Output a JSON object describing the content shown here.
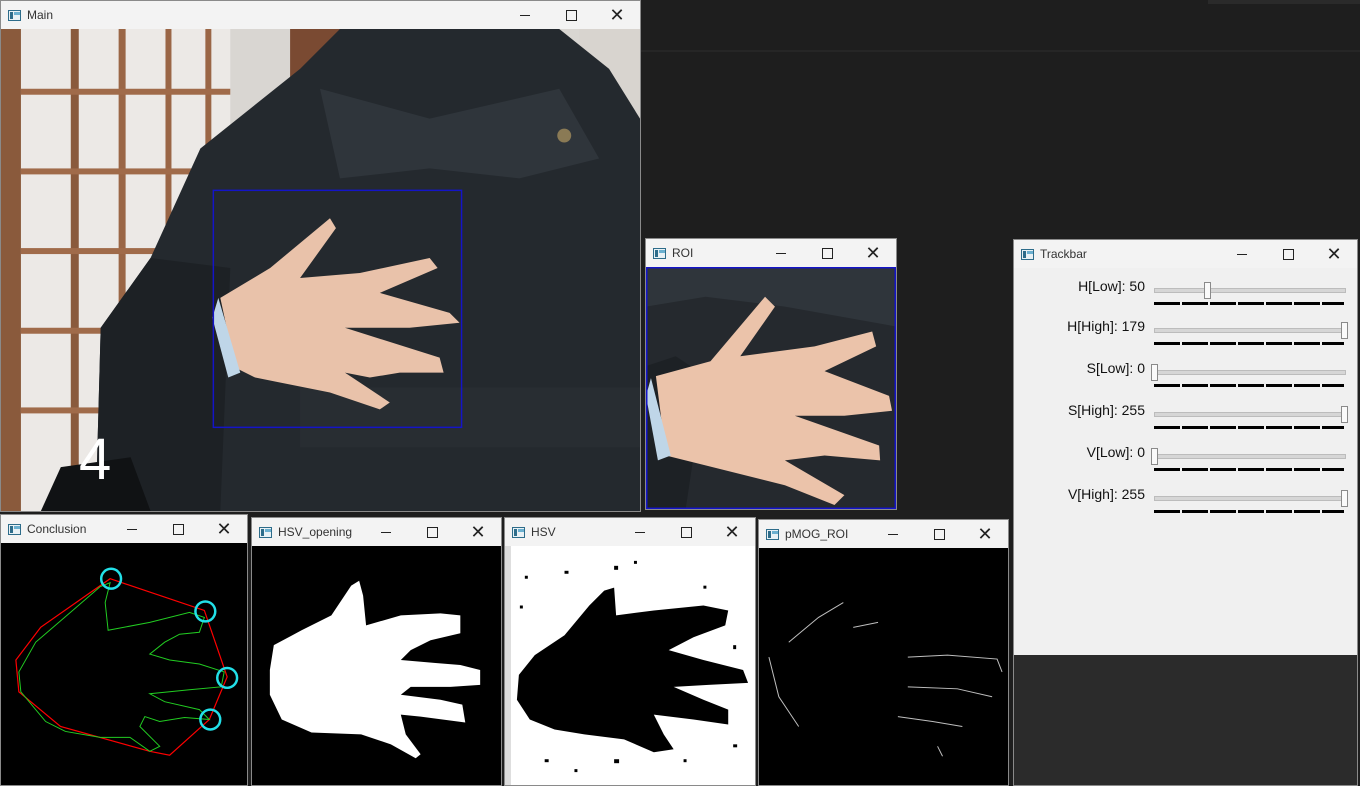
{
  "colors": {
    "desktop": "#1e1e1e",
    "roi_box": "#1414c8",
    "hull": "#ff0000",
    "contour": "#22cc22",
    "fingertip": "#22e0e8"
  },
  "windows": {
    "main": {
      "title": "Main",
      "overlay_digit": "4"
    },
    "roi": {
      "title": "ROI"
    },
    "trackbar": {
      "title": "Trackbar"
    },
    "conclusion": {
      "title": "Conclusion"
    },
    "hsv_opening": {
      "title": "HSV_opening"
    },
    "hsv": {
      "title": "HSV"
    },
    "pmog": {
      "title": "pMOG_ROI"
    }
  },
  "trackbar": {
    "sliders": [
      {
        "label": "H[Low]: 50",
        "value": 50,
        "max": 179
      },
      {
        "label": "H[High]: 179",
        "value": 179,
        "max": 179
      },
      {
        "label": "S[Low]: 0",
        "value": 0,
        "max": 255
      },
      {
        "label": "S[High]: 255",
        "value": 255,
        "max": 255
      },
      {
        "label": "V[Low]: 0",
        "value": 0,
        "max": 255
      },
      {
        "label": "V[High]: 255",
        "value": 255,
        "max": 255
      }
    ]
  },
  "icons": {
    "window": "app-window-icon",
    "minimize": "minimize-icon",
    "maximize": "maximize-icon",
    "close": "close-icon"
  },
  "close_glyph": "✕"
}
